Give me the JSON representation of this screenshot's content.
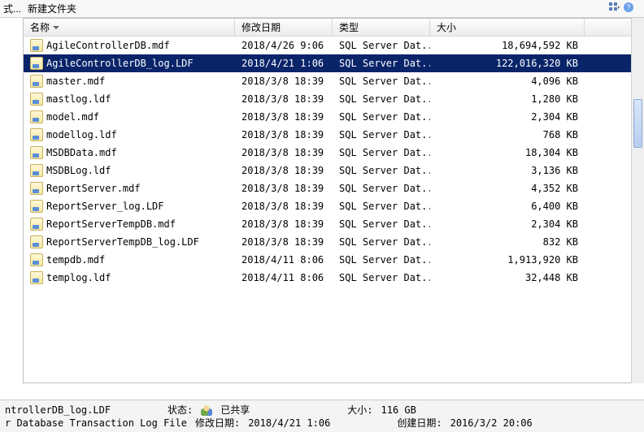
{
  "toolbar": {
    "left_truncated": "式...",
    "new_folder": "新建文件夹"
  },
  "view_toggle": {
    "tooltip": "视图"
  },
  "columns": {
    "name": "名称",
    "date": "修改日期",
    "type": "类型",
    "size": "大小"
  },
  "files": [
    {
      "name": "AgileControllerDB.mdf",
      "date": "2018/4/26 9:06",
      "type": "SQL Server Dat...",
      "size": "18,694,592 KB",
      "selected": false
    },
    {
      "name": "AgileControllerDB_log.LDF",
      "date": "2018/4/21 1:06",
      "type": "SQL Server Dat...",
      "size": "122,016,320 KB",
      "selected": true
    },
    {
      "name": "master.mdf",
      "date": "2018/3/8 18:39",
      "type": "SQL Server Dat...",
      "size": "4,096 KB",
      "selected": false
    },
    {
      "name": "mastlog.ldf",
      "date": "2018/3/8 18:39",
      "type": "SQL Server Dat...",
      "size": "1,280 KB",
      "selected": false
    },
    {
      "name": "model.mdf",
      "date": "2018/3/8 18:39",
      "type": "SQL Server Dat...",
      "size": "2,304 KB",
      "selected": false
    },
    {
      "name": "modellog.ldf",
      "date": "2018/3/8 18:39",
      "type": "SQL Server Dat...",
      "size": "768 KB",
      "selected": false
    },
    {
      "name": "MSDBData.mdf",
      "date": "2018/3/8 18:39",
      "type": "SQL Server Dat...",
      "size": "18,304 KB",
      "selected": false
    },
    {
      "name": "MSDBLog.ldf",
      "date": "2018/3/8 18:39",
      "type": "SQL Server Dat...",
      "size": "3,136 KB",
      "selected": false
    },
    {
      "name": "ReportServer.mdf",
      "date": "2018/3/8 18:39",
      "type": "SQL Server Dat...",
      "size": "4,352 KB",
      "selected": false
    },
    {
      "name": "ReportServer_log.LDF",
      "date": "2018/3/8 18:39",
      "type": "SQL Server Dat...",
      "size": "6,400 KB",
      "selected": false
    },
    {
      "name": "ReportServerTempDB.mdf",
      "date": "2018/3/8 18:39",
      "type": "SQL Server Dat...",
      "size": "2,304 KB",
      "selected": false
    },
    {
      "name": "ReportServerTempDB_log.LDF",
      "date": "2018/3/8 18:39",
      "type": "SQL Server Dat...",
      "size": "832 KB",
      "selected": false
    },
    {
      "name": "tempdb.mdf",
      "date": "2018/4/11 8:06",
      "type": "SQL Server Dat...",
      "size": "1,913,920 KB",
      "selected": false
    },
    {
      "name": "templog.ldf",
      "date": "2018/4/11 8:06",
      "type": "SQL Server Dat...",
      "size": "32,448 KB",
      "selected": false
    }
  ],
  "status": {
    "selected_name": "ntrollerDB_log.LDF",
    "state_label": "状态:",
    "state_value": "已共享",
    "size_label": "大小:",
    "size_value": "116 GB",
    "type_line": "r Database Transaction Log File",
    "mod_label": "修改日期:",
    "mod_value": "2018/4/21 1:06",
    "created_label": "创建日期:",
    "created_value": "2016/3/2 20:06"
  }
}
